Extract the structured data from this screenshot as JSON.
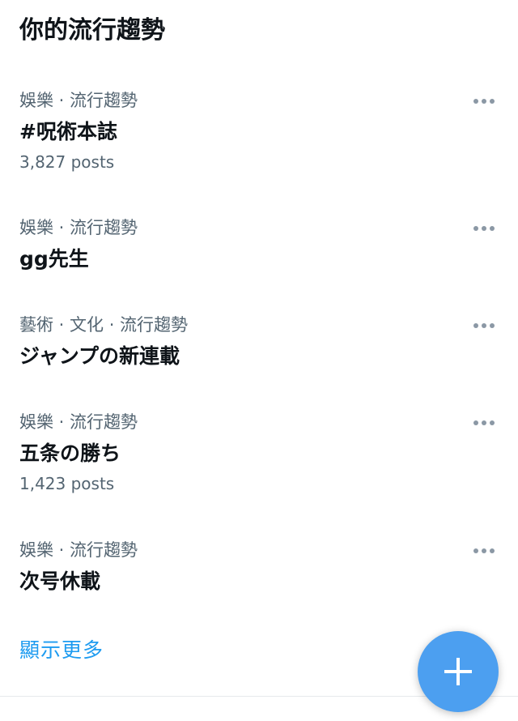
{
  "header": {
    "title": "你的流行趨勢"
  },
  "trends": [
    {
      "meta": "娛樂 · 流行趨勢",
      "name": "#呪術本誌",
      "count": "3,827 posts"
    },
    {
      "meta": "娛樂 · 流行趨勢",
      "name": "gg先生"
    },
    {
      "meta": "藝術 · 文化 · 流行趨勢",
      "name": "ジャンプの新連載"
    },
    {
      "meta": "娛樂 · 流行趨勢",
      "name": "五条の勝ち",
      "count": "1,423 posts"
    },
    {
      "meta": "娛樂 · 流行趨勢",
      "name": "次号休載"
    }
  ],
  "footer": {
    "show_more": "顯示更多"
  },
  "icons": {
    "more": "more-horizontal-icon",
    "compose": "plus-icon"
  },
  "colors": {
    "accent": "#1d9bf0",
    "fab": "#4c9ff0",
    "secondary_text": "#536471",
    "primary_text": "#0f1419"
  }
}
